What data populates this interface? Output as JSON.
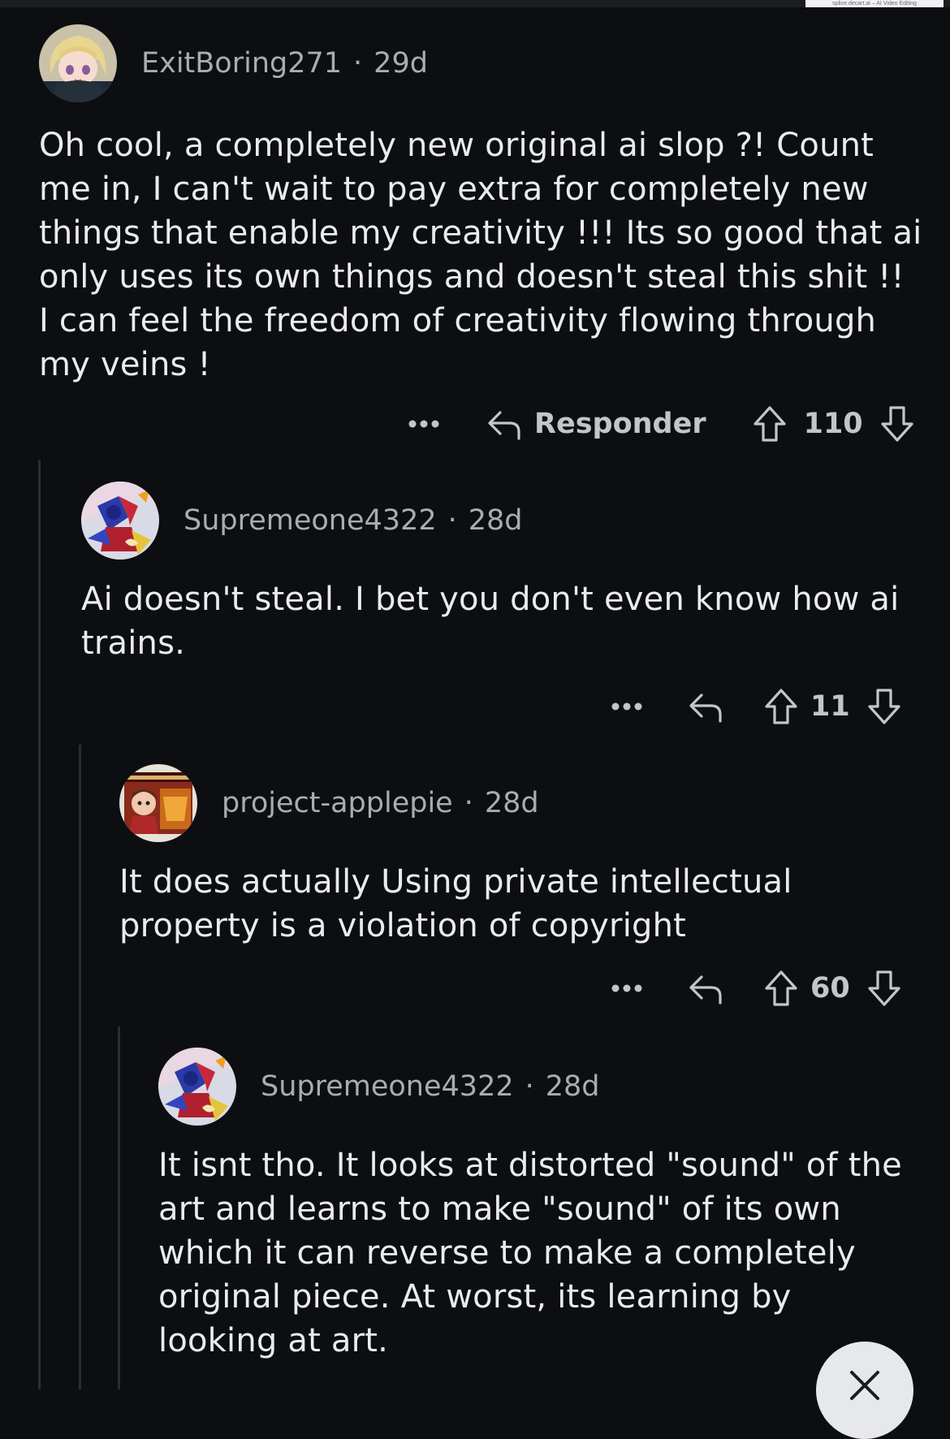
{
  "watermark": "splice.decart.ai – AI Video Editing",
  "comments": [
    {
      "username": "ExitBoring271",
      "dot": "·",
      "age": "29d",
      "lines": [
        "Oh cool, a completely new original ai slop ?! Count",
        "me in, I can't wait to pay extra for completely new",
        "things that enable my creativity !!! Its so good that ai",
        "only uses its own things and doesn't steal this shit !!",
        "I can feel the freedom of creativity flowing through",
        "my veins !"
      ],
      "reply_label": "Responder",
      "votes": "110",
      "avatar_icon": "anime-girl-avatar-icon"
    },
    {
      "username": "Supremeone4322",
      "dot": "·",
      "age": "28d",
      "lines": [
        "Ai doesn't steal. I bet you don't even know how ai",
        "trains."
      ],
      "votes": "11",
      "avatar_icon": "robot-hero-avatar-icon"
    },
    {
      "username": "project-applepie",
      "dot": "·",
      "age": "28d",
      "lines": [
        "It does actually Using private intellectual",
        "property is a violation of copyright"
      ],
      "votes": "60",
      "avatar_icon": "character-poster-avatar-icon"
    },
    {
      "username": "Supremeone4322",
      "dot": "·",
      "age": "28d",
      "lines": [
        "It isnt tho. It looks at distorted \"sound\" of the",
        "art and learns to make \"sound\" of its own",
        "which it can reverse to make a completely",
        "original piece. At worst, its learning by",
        "looking at art."
      ],
      "avatar_icon": "robot-hero-avatar-icon"
    }
  ],
  "icons": {
    "more": "more-options-icon",
    "reply": "reply-icon",
    "upvote": "upvote-icon",
    "downvote": "downvote-icon",
    "close": "close-icon"
  }
}
